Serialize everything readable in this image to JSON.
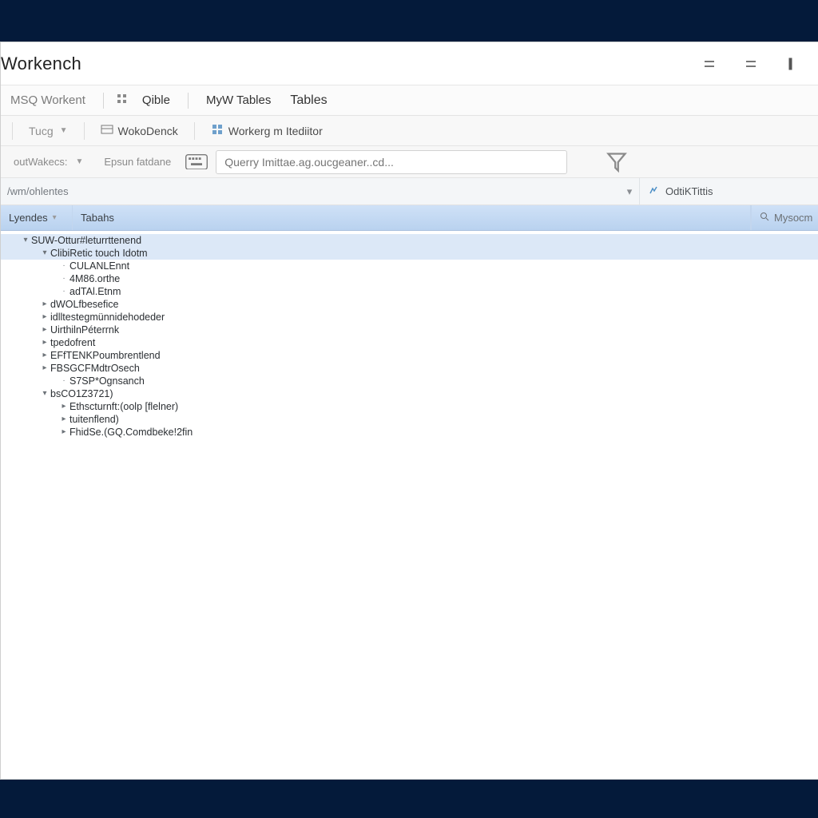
{
  "title": "Workench",
  "menubar": {
    "items": [
      "MSQ Workent",
      "Qible",
      "MyW Tables",
      "Tables"
    ]
  },
  "toolbar": {
    "items": [
      {
        "label": "Tucg",
        "dropdown": true
      },
      {
        "label": "WokoDenck",
        "icon": "workbench-icon"
      },
      {
        "label": "Workerg m Itediitor",
        "icon": "editor-icon"
      }
    ]
  },
  "querybar": {
    "combo1": "outWakecs:",
    "combo2": "Epsun fatdane",
    "input_placeholder": "Querry Imittae.ag.oucgeaner..cd..."
  },
  "pathbar": {
    "path": "/wm/ohlentes",
    "right_label": "OdtiKTittis"
  },
  "columns": {
    "c1": "Lyendes",
    "c2": "Tabahs",
    "search": "Mysocm"
  },
  "tree": [
    {
      "d": 0,
      "exp": "open",
      "label": "SUW-Ottur#leturrttenend",
      "sel": true
    },
    {
      "d": 1,
      "exp": "open",
      "label": "ClibiRetic touch Idotm",
      "sel": true
    },
    {
      "d": 2,
      "exp": "leaf",
      "label": "CULANLEnnt"
    },
    {
      "d": 2,
      "exp": "leaf",
      "label": "4M86.orthe"
    },
    {
      "d": 2,
      "exp": "leaf",
      "label": "adTAl.Etnm"
    },
    {
      "d": 1,
      "exp": "closed",
      "label": "dWOLfbesefice"
    },
    {
      "d": 1,
      "exp": "closed",
      "label": "idlltestegmünnidehodeder"
    },
    {
      "d": 1,
      "exp": "closed",
      "label": "UirthilnPéterrnk"
    },
    {
      "d": 1,
      "exp": "closed",
      "label": "tpedofrent"
    },
    {
      "d": 1,
      "exp": "closed",
      "label": "EFfTENKPoumbrentlend"
    },
    {
      "d": 1,
      "exp": "closed",
      "label": "FBSGCFMdtrOsech"
    },
    {
      "d": 2,
      "exp": "leaf",
      "label": "S7SP*Ognsanch"
    },
    {
      "d": 1,
      "exp": "open",
      "label": "bsCO1Z3721)"
    },
    {
      "d": 2,
      "exp": "closed",
      "label": "Ethscturnft:(oolp [flelner)"
    },
    {
      "d": 2,
      "exp": "closed",
      "label": "tuitenflend)"
    },
    {
      "d": 2,
      "exp": "closed",
      "label": "FhidSe.(GQ.Comdbeke!2fin"
    }
  ]
}
